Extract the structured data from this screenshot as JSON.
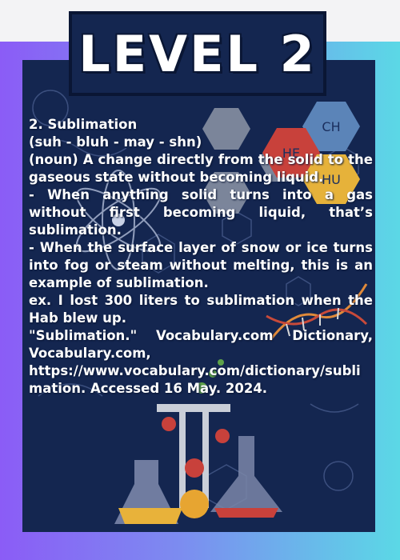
{
  "title": "LEVEL 2",
  "entry": {
    "heading": "2. Sublimation",
    "pronunciation": "(suh - bluh - may - shn)",
    "definition": "(noun) A change directly from the solid to the gaseous state without becoming liquid.",
    "example1": "- When anything solid turns into a gas without first becoming liquid, that’s sublimation.",
    "example2": "- When the surface layer of snow or ice turns into fog or steam without melting, this is an example of sublimation.",
    "sentence": "ex. I lost 300 liters to sublimation when the Hab blew up.",
    "citation_line1": "\"Sublimation.\" Vocabulary.com Dictionary, Vocabulary.com,",
    "citation_line2": "https://www.vocabulary.com/dictionary/sublimation. Accessed 16 May. 2024."
  },
  "background_labels": {
    "hex1": "CH",
    "hex2": "HE",
    "hex3": "HU"
  },
  "colors": {
    "board": "#142650",
    "gradient_left": "#8b5cf6",
    "gradient_right": "#5bd8e6",
    "hex_red": "#c8413b",
    "hex_yellow": "#e6b23a",
    "hex_blue": "#5b84b8"
  }
}
